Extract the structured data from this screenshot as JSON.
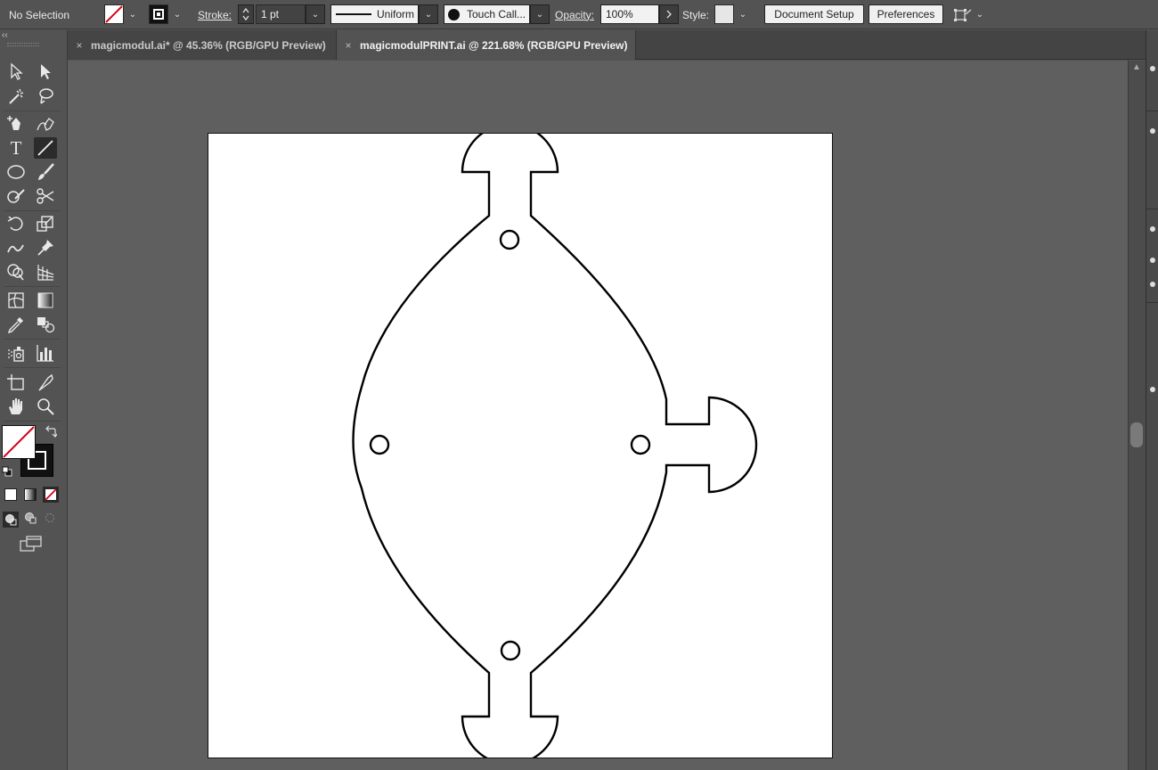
{
  "control_bar": {
    "selection_status": "No Selection",
    "stroke_label": "Stroke:",
    "stroke_weight": "1 pt",
    "stroke_profile": "Uniform",
    "brush_name": "Touch Call...",
    "opacity_label": "Opacity:",
    "opacity_value": "100%",
    "style_label": "Style:",
    "document_setup": "Document Setup",
    "preferences": "Preferences"
  },
  "tabs": [
    {
      "label": "magicmodul.ai* @ 45.36% (RGB/GPU Preview)",
      "active": false
    },
    {
      "label": "magicmodulPRINT.ai @ 221.68% (RGB/GPU Preview)",
      "active": true
    }
  ],
  "tools": {
    "type_glyph": "T",
    "active_tool": "line-segment-tool"
  },
  "colors": {
    "ui_background": "#535353",
    "canvas": "#5f5f5f",
    "artboard": "#ffffff",
    "fill_none_slash": "#d0021b",
    "stroke": "#000000"
  },
  "icons": {
    "close_tab": "×",
    "caret": "⌄",
    "collapse": "‹‹",
    "scroll_up": "▲"
  }
}
